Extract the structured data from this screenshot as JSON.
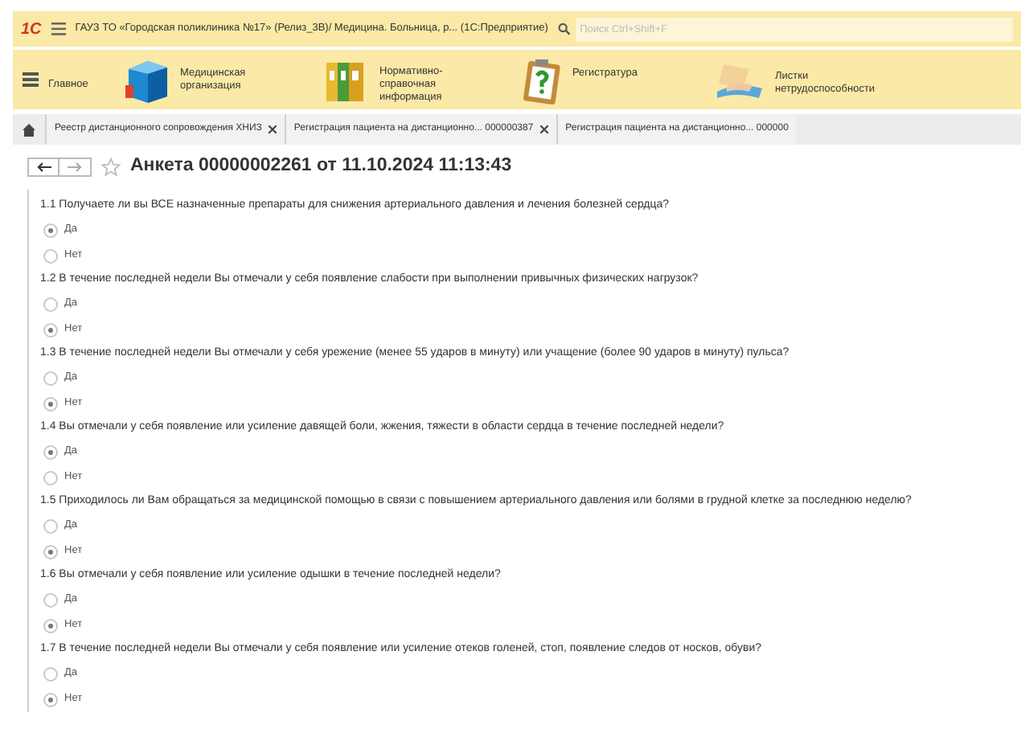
{
  "window": {
    "logo": "1С",
    "title": "ГАУЗ ТО «Городская поликлиника №17» (Релиз_3В)/ Медицина. Больница, р...  (1С:Предприятие)",
    "search": {
      "placeholder": "Поиск Ctrl+Shift+F"
    }
  },
  "sections": [
    {
      "kind": "menu",
      "label": "Главное"
    },
    {
      "kind": "cube",
      "label": "Медицинская организация"
    },
    {
      "kind": "binders",
      "label": "Нормативно-справочная информация"
    },
    {
      "kind": "clipboard",
      "label": "Регистратура"
    },
    {
      "kind": "hand",
      "label": "Листки нетрудоспособности"
    }
  ],
  "tabs": [
    {
      "label": "Реестр дистанционного сопровождения ХНИЗ",
      "selected": false
    },
    {
      "label": "Регистрация пациента на дистанционно... 000000387",
      "selected": false
    },
    {
      "label": "Регистрация пациента на дистанционно... 000000",
      "selected": false
    }
  ],
  "form": {
    "title": "Анкета 00000002261 от 11.10.2024 11:13:43"
  },
  "questions": [
    {
      "text": "1.1 Получаете ли вы ВСЕ назначенные препараты для снижения артериального давления и лечения болезней сердца?",
      "options": [
        {
          "label": "Да",
          "selected": true
        },
        {
          "label": "Нет",
          "selected": false
        }
      ]
    },
    {
      "text": "1.2 В течение последней недели Вы отмечали у себя появление слабости при выполнении привычных физических нагрузок?",
      "options": [
        {
          "label": "Да",
          "selected": false
        },
        {
          "label": "Нет",
          "selected": true
        }
      ]
    },
    {
      "text": "1.3 В течение последней недели Вы отмечали у себя урежение (менее 55 ударов в минуту) или учащение (более 90 ударов в минуту) пульса?",
      "options": [
        {
          "label": "Да",
          "selected": false
        },
        {
          "label": "Нет",
          "selected": true
        }
      ]
    },
    {
      "text": "1.4 Вы отмечали у себя появление или усиление давящей боли, жжения, тяжести в области сердца в течение последней недели?",
      "options": [
        {
          "label": "Да",
          "selected": true
        },
        {
          "label": "Нет",
          "selected": false
        }
      ]
    },
    {
      "text": "1.5 Приходилось ли Вам обращаться за медицинской помощью в связи с повышением артериального давления или болями в грудной клетке за последнюю неделю?",
      "options": [
        {
          "label": "Да",
          "selected": false
        },
        {
          "label": "Нет",
          "selected": true
        }
      ]
    },
    {
      "text": "1.6 Вы отмечали у себя появление или усиление одышки в течение последней недели?",
      "options": [
        {
          "label": "Да",
          "selected": false
        },
        {
          "label": "Нет",
          "selected": true
        }
      ]
    },
    {
      "text": "1.7 В течение последней недели Вы отмечали у себя появление или усиление отеков голеней, стоп, появление следов от носков, обуви?",
      "options": [
        {
          "label": "Да",
          "selected": false
        },
        {
          "label": "Нет",
          "selected": true
        }
      ]
    }
  ]
}
